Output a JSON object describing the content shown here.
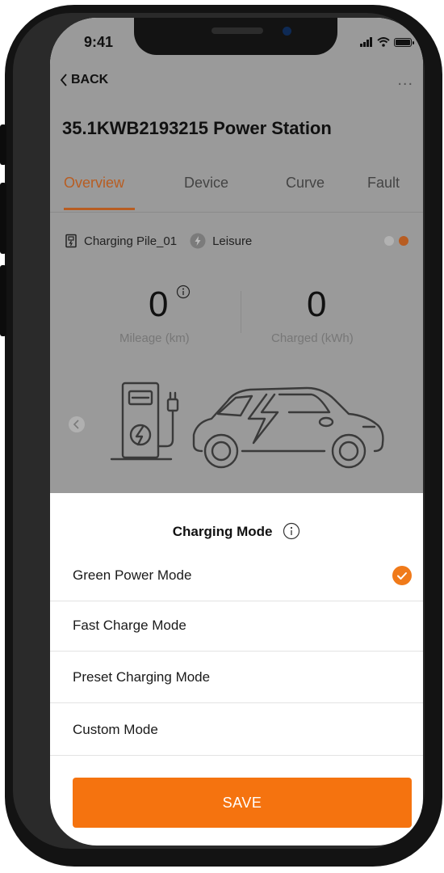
{
  "status_bar": {
    "time": "9:41"
  },
  "nav": {
    "back_label": "BACK",
    "more_label": "..."
  },
  "page_title": "35.1KWB2193215 Power Station",
  "tabs": [
    {
      "label": "Overview",
      "active": true
    },
    {
      "label": "Device",
      "active": false
    },
    {
      "label": "Curve",
      "active": false
    },
    {
      "label": "Fault",
      "active": false
    }
  ],
  "pile": {
    "name": "Charging Pile_01",
    "status": "Leisure"
  },
  "pager": {
    "count": 2,
    "active_index": 1
  },
  "stats": [
    {
      "value": "0",
      "label": "Mileage (km)"
    },
    {
      "value": "0",
      "label": "Charged (kWh)"
    }
  ],
  "sheet": {
    "title": "Charging Mode",
    "modes": [
      {
        "label": "Green Power Mode",
        "selected": true
      },
      {
        "label": "Fast Charge Mode",
        "selected": false
      },
      {
        "label": "Preset Charging Mode",
        "selected": false
      },
      {
        "label": "Custom Mode",
        "selected": false
      }
    ],
    "save_label": "SAVE"
  },
  "colors": {
    "accent": "#f5730f",
    "tab_active": "#b85d22",
    "dim_overlay": "#9a9a9a"
  }
}
